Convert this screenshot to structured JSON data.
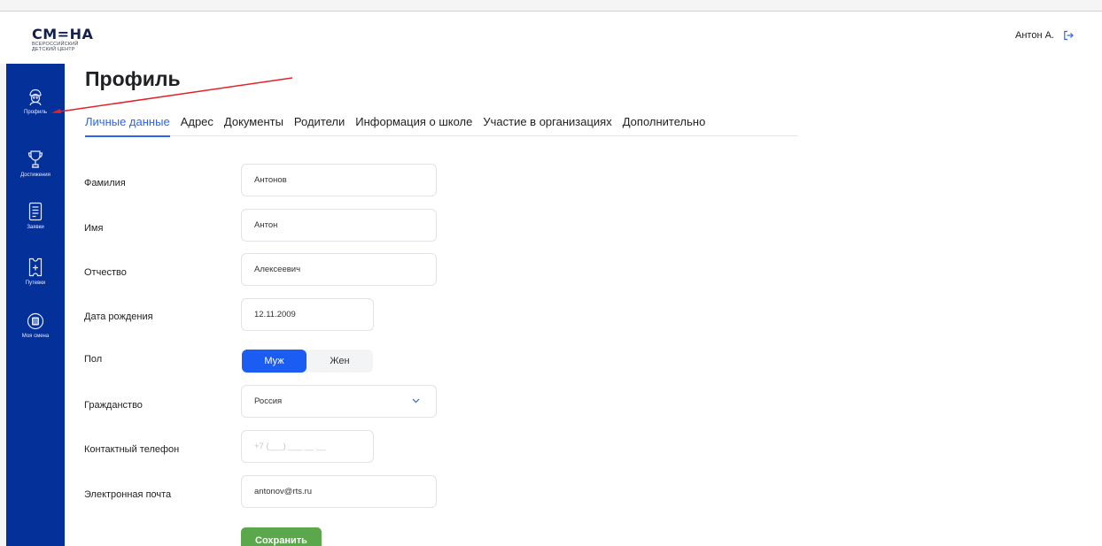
{
  "header": {
    "logo_main": "СМ=НА",
    "logo_line1": "ВСЕРОССИЙСКИЙ",
    "logo_line2": "ДЕТСКИЙ ЦЕНТР",
    "user_name": "Антон А."
  },
  "sidebar": {
    "items": [
      {
        "label": "Профиль",
        "icon": "profile-icon"
      },
      {
        "label": "Достижения",
        "icon": "trophy-icon"
      },
      {
        "label": "Заявки",
        "icon": "document-icon"
      },
      {
        "label": "Путевки",
        "icon": "voucher-icon"
      },
      {
        "label": "Моя смена",
        "icon": "list-circle-icon"
      }
    ]
  },
  "page": {
    "title": "Профиль"
  },
  "tabs": [
    {
      "label": "Личные данные",
      "active": true
    },
    {
      "label": "Адрес"
    },
    {
      "label": "Документы"
    },
    {
      "label": "Родители"
    },
    {
      "label": "Информация о школе"
    },
    {
      "label": "Участие в организациях"
    },
    {
      "label": "Дополнительно"
    }
  ],
  "form": {
    "last_name": {
      "label": "Фамилия",
      "value": "Антонов"
    },
    "first_name": {
      "label": "Имя",
      "value": "Антон"
    },
    "patronymic": {
      "label": "Отчество",
      "value": "Алексеевич"
    },
    "birth_date": {
      "label": "Дата рождения",
      "value": "12.11.2009"
    },
    "gender": {
      "label": "Пол",
      "options": [
        "Муж",
        "Жен"
      ],
      "selected": "Муж"
    },
    "citizenship": {
      "label": "Гражданство",
      "value": "Россия"
    },
    "phone": {
      "label": "Контактный телефон",
      "placeholder": "+7 (___) ___ __ __"
    },
    "email": {
      "label": "Электронная почта",
      "value": "antonov@rts.ru"
    },
    "save_label": "Сохранить"
  },
  "colors": {
    "sidebar": "#04309a",
    "accent": "#2e63ea",
    "toggle_active": "#1b5cf2",
    "save": "#5ba74c",
    "annotation": "#e0242a"
  }
}
